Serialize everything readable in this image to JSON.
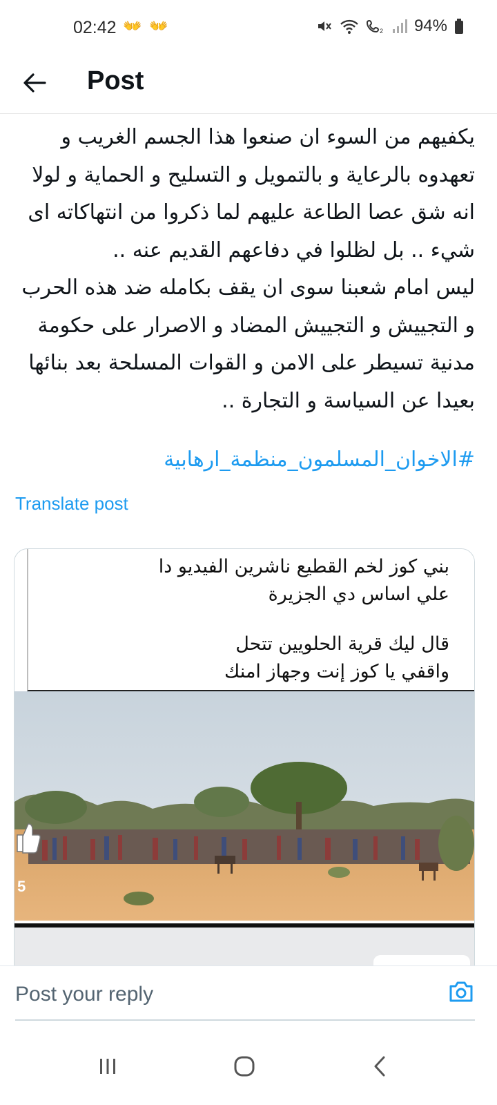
{
  "status_bar": {
    "time": "02:42",
    "notification_glyphs": "👐 👐",
    "battery": "94%",
    "icons": [
      "mute-icon",
      "wifi-icon",
      "wifi-call-icon",
      "signal-icon",
      "battery-icon"
    ]
  },
  "header": {
    "title": "Post",
    "back_icon": "arrow-left-icon"
  },
  "post": {
    "paragraph_1": "يكفيهم من السوء ان صنعوا هذا الجسم الغريب و تعهدوه بالرعاية و بالتمويل و التسليح و الحماية و لولا انه شق عصا الطاعة عليهم لما ذكروا من انتهاكاته اى شيء .. بل لظلوا في دفاعهم القديم عنه ..",
    "paragraph_2": "ليس امام شعبنا سوى ان يقف بكامله ضد هذه الحرب و التجييش و التجييش المضاد و الاصرار على حكومة مدنية تسيطر على الامن و القوات المسلحة بعد بنائها بعيدا عن السياسة و التجارة ..",
    "hashtag": "#الاخوان_المسلمون_منظمة_ارهابية",
    "translate_label": "Translate post"
  },
  "media": {
    "caption_line_1": "بني كوز لخم القطيع ناشرين الفيديو دا",
    "caption_line_2": "علي اساس دي الجزيرة",
    "caption_line_3": "قال ليك قرية الحلويين تتحل",
    "caption_line_4": "واقفي يا كوز إنت وجهاز امنك",
    "overlay_number": "5",
    "overlay_icon": "thumbs-up-icon"
  },
  "reply": {
    "placeholder": "Post your reply",
    "camera_icon": "camera-icon"
  },
  "nav": {
    "icons": [
      "recent-apps-icon",
      "home-icon",
      "back-icon"
    ]
  },
  "colors": {
    "accent": "#1d9bf0",
    "text": "#0f1419",
    "muted": "#536471"
  }
}
